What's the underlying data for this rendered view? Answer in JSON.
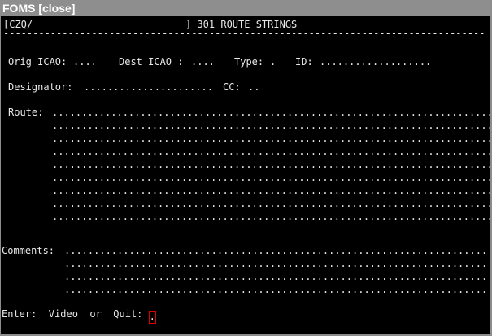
{
  "window": {
    "title": "FOMS",
    "close_label": "[close]"
  },
  "header": {
    "left": "[CZQ/",
    "right": "] 301 ROUTE STRINGS"
  },
  "separator": "-------------------------------------------------------------------------------------------------",
  "fields": {
    "orig_icao_label": "Orig ICAO:",
    "orig_icao_value": "....",
    "dest_icao_label": "Dest ICAO :",
    "dest_icao_value": "....",
    "type_label": "Type:",
    "type_value": ".",
    "id_label": "ID:",
    "id_value": "...................",
    "designator_label": "Designator:",
    "designator_value": "......................",
    "cc_label": "CC:",
    "cc_value": ".."
  },
  "route": {
    "label": "Route:",
    "lines": [
      "..................................................................................",
      "..................................................................................",
      "..................................................................................",
      "..................................................................................",
      "..................................................................................",
      "..................................................................................",
      "..................................................................................",
      "..................................................................................",
      ".................................................................................."
    ]
  },
  "comments": {
    "label": "Comments:",
    "lines": [
      "..................................................................................",
      "..................................................................................",
      "..................................................................................",
      ".................................................................................."
    ]
  },
  "prompt": {
    "text": "Enter:  Video  or  Quit:",
    "input_value": "."
  },
  "colors": {
    "screen_bg": "#000000",
    "screen_fg": "#e8e8e8",
    "titlebar_bg": "#8e8e8e",
    "cursor_border": "#e00000"
  }
}
